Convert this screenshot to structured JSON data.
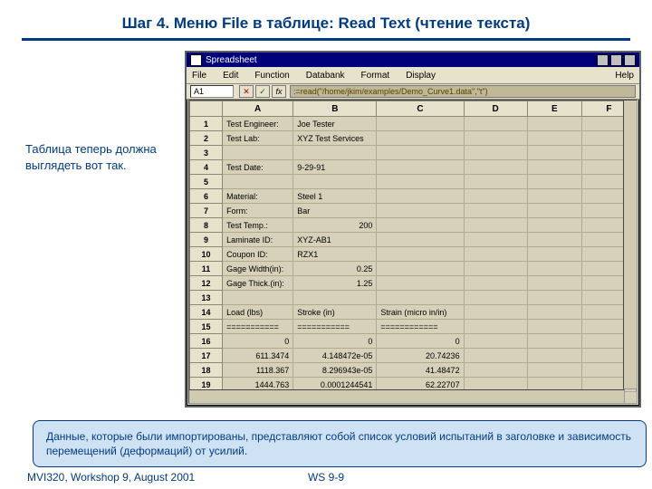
{
  "heading": "Шаг 4.  Меню File в таблице:  Read Text (чтение текста)",
  "sidenote": "Таблица теперь должна выглядеть вот так.",
  "window": {
    "title": "Spreadsheet",
    "menus": [
      "File",
      "Edit",
      "Function",
      "Databank",
      "Format",
      "Display"
    ],
    "help": "Help",
    "cellref": "A1",
    "formula": ":=read(\"/home/jkim/examples/Demo_Curve1.data\",\"t\")",
    "cols": [
      "",
      "A",
      "B",
      "C",
      "D",
      "E",
      "F"
    ],
    "rows": [
      {
        "n": "1",
        "a": "Test Engineer:",
        "b": "Joe Tester",
        "c": "",
        "bNum": false
      },
      {
        "n": "2",
        "a": "Test Lab:",
        "b": "XYZ Test Services",
        "c": "",
        "bNum": false
      },
      {
        "n": "3",
        "a": "",
        "b": "",
        "c": ""
      },
      {
        "n": "4",
        "a": "Test Date:",
        "b": "9-29-91",
        "c": "",
        "bNum": false
      },
      {
        "n": "5",
        "a": "",
        "b": "",
        "c": ""
      },
      {
        "n": "6",
        "a": "Material:",
        "b": "Steel 1",
        "c": "",
        "bNum": false
      },
      {
        "n": "7",
        "a": "Form:",
        "b": "Bar",
        "c": "",
        "bNum": false
      },
      {
        "n": "8",
        "a": "Test Temp.:",
        "b": "200",
        "c": "",
        "bNum": true
      },
      {
        "n": "9",
        "a": "Laminate ID:",
        "b": "XYZ-AB1",
        "c": "",
        "bNum": false
      },
      {
        "n": "10",
        "a": "Coupon ID:",
        "b": "RZX1",
        "c": "",
        "bNum": false
      },
      {
        "n": "11",
        "a": "Gage Width(in):",
        "b": "0.25",
        "c": "",
        "bNum": true
      },
      {
        "n": "12",
        "a": "Gage Thick.(in):",
        "b": "1.25",
        "c": "",
        "bNum": true
      },
      {
        "n": "13",
        "a": "",
        "b": "",
        "c": ""
      },
      {
        "n": "14",
        "a": "Load (lbs)",
        "b": "Stroke (in)",
        "c": "Strain (micro in/in)",
        "bNum": false
      },
      {
        "n": "15",
        "a": "===========",
        "b": "===========",
        "c": "============",
        "bNum": false
      },
      {
        "n": "16",
        "a": "0",
        "b": "0",
        "c": "0",
        "aNum": true,
        "bNum": true,
        "cNum": true
      },
      {
        "n": "17",
        "a": "611.3474",
        "b": "4.148472e-05",
        "c": "20.74236",
        "aNum": true,
        "bNum": true,
        "cNum": true
      },
      {
        "n": "18",
        "a": "1118.367",
        "b": "8.296943e-05",
        "c": "41.48472",
        "aNum": true,
        "bNum": true,
        "cNum": true
      },
      {
        "n": "19",
        "a": "1444.763",
        "b": "0.0001244541",
        "c": "62.22707",
        "aNum": true,
        "bNum": true,
        "cNum": true
      }
    ]
  },
  "callout": "Данные, которые были импортированы, представляют собой список условий испытаний в заголовке и зависимость перемещений (деформаций) от усилий.",
  "footer": {
    "left": "MVI320, Workshop 9, August 2001",
    "center": "WS 9-9"
  }
}
